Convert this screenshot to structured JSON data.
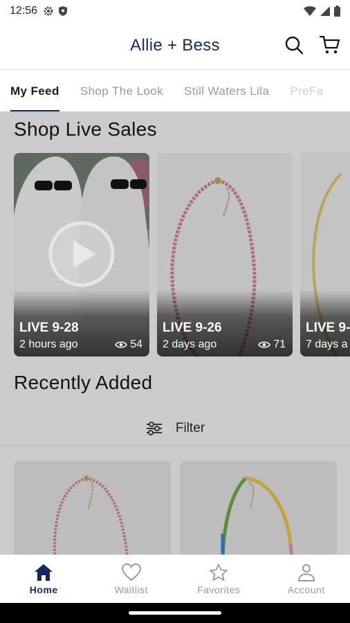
{
  "status_bar": {
    "time": "12:56"
  },
  "header": {
    "title": "Allie + Bess"
  },
  "tabs": [
    {
      "label": "My Feed",
      "active": true
    },
    {
      "label": "Shop The Look",
      "active": false
    },
    {
      "label": "Still Waters Lila",
      "active": false
    },
    {
      "label": "PreFa",
      "active": false
    }
  ],
  "live_sales": {
    "title": "Shop Live Sales",
    "cards": [
      {
        "label": "LIVE 9-28",
        "ago": "2 hours ago",
        "views": "54"
      },
      {
        "label": "LIVE 9-26",
        "ago": "2 days ago",
        "views": "71"
      },
      {
        "label": "LIVE 9-",
        "ago": "7 days a",
        "views": ""
      }
    ]
  },
  "recently_added": {
    "title": "Recently Added",
    "filter_label": "Filter"
  },
  "bottom_nav": [
    {
      "label": "Home",
      "icon": "home-icon",
      "active": true
    },
    {
      "label": "Waitlist",
      "icon": "heart-icon",
      "active": false
    },
    {
      "label": "Favorites",
      "icon": "star-icon",
      "active": false
    },
    {
      "label": "Account",
      "icon": "person-icon",
      "active": false
    }
  ],
  "colors": {
    "brand": "#16285e",
    "overlay": "#cbcbcb"
  }
}
